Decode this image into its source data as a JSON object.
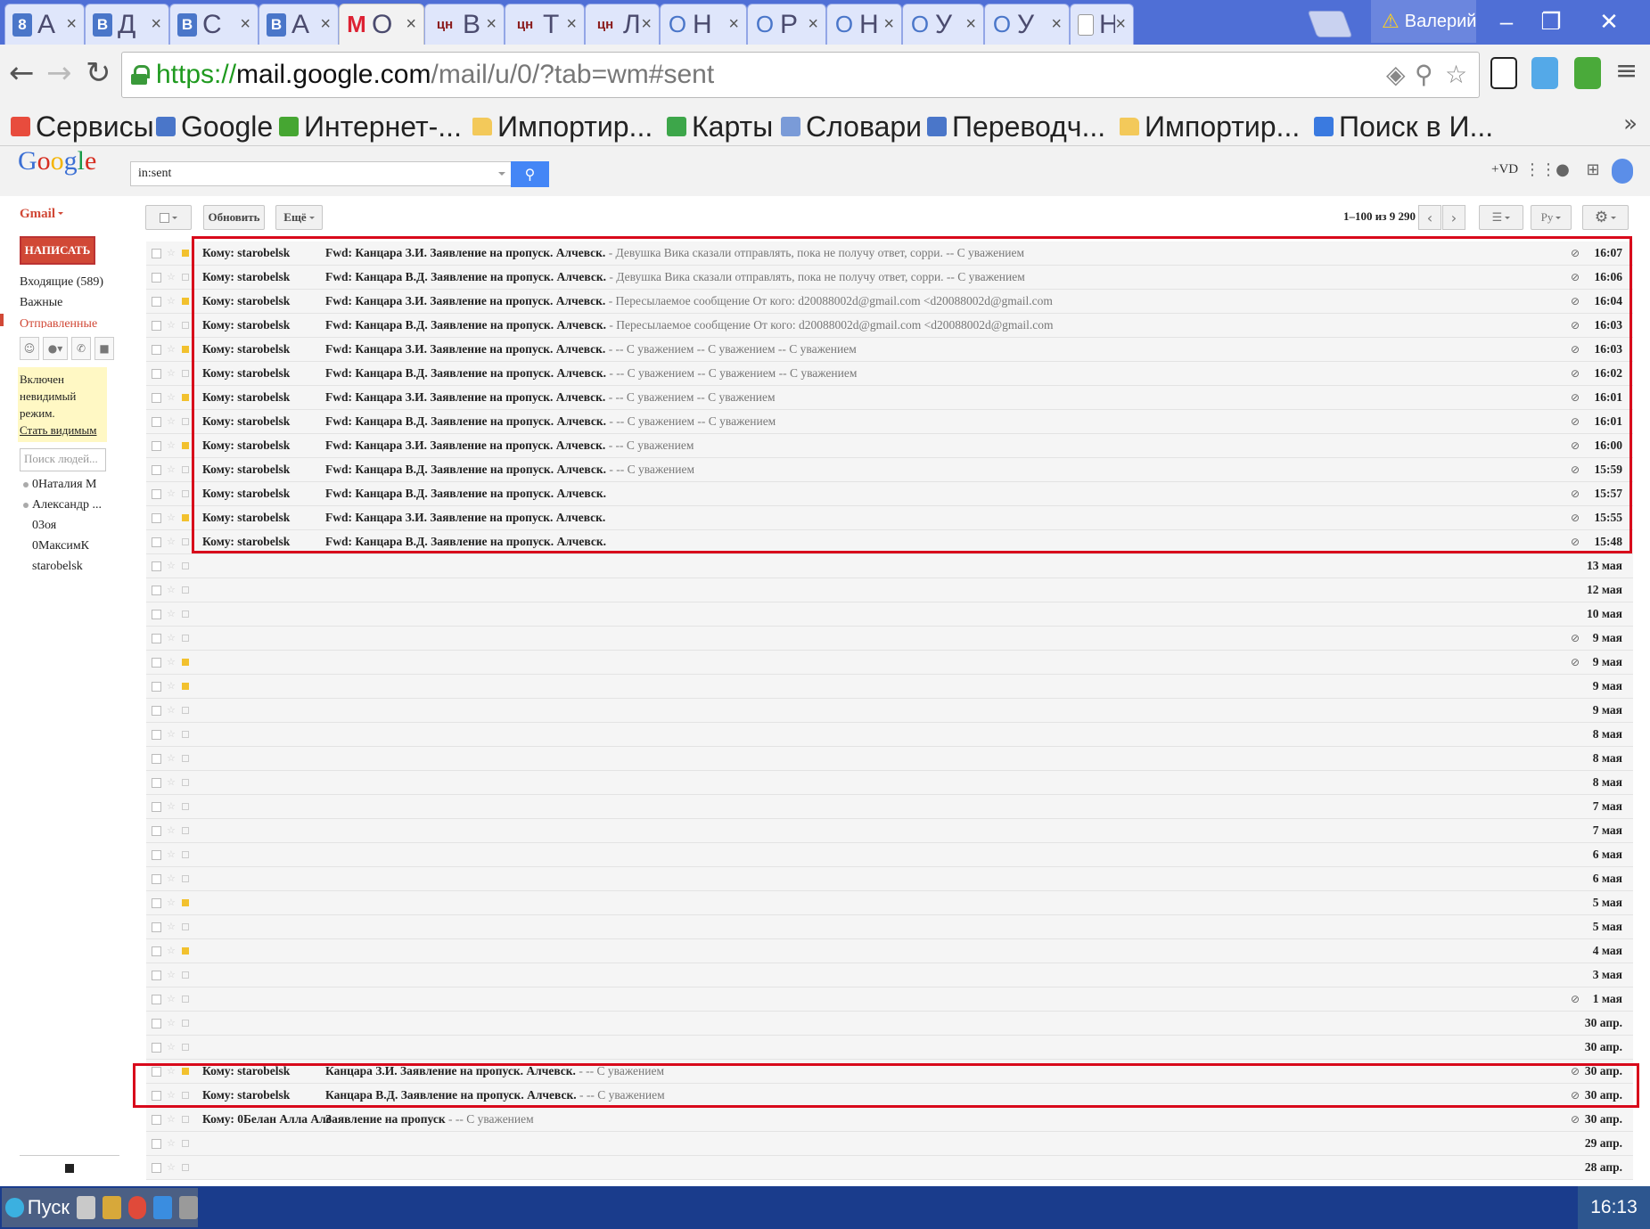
{
  "browser": {
    "tabs": [
      {
        "icon": "8",
        "label": "А",
        "kind": "vk"
      },
      {
        "icon": "B",
        "label": "Д",
        "kind": "vk"
      },
      {
        "icon": "B",
        "label": "С",
        "kind": "vk"
      },
      {
        "icon": "B",
        "label": "А",
        "kind": "vk"
      },
      {
        "icon": "M",
        "label": "О",
        "kind": "gm",
        "active": true
      },
      {
        "icon": "цн",
        "label": "В",
        "kind": "cn"
      },
      {
        "icon": "цн",
        "label": "Т",
        "kind": "cn"
      },
      {
        "icon": "цн",
        "label": "Л",
        "kind": "cn"
      },
      {
        "icon": "O",
        "label": "Н",
        "kind": "op"
      },
      {
        "icon": "O",
        "label": "Р",
        "kind": "op"
      },
      {
        "icon": "O",
        "label": "Н",
        "kind": "op"
      },
      {
        "icon": "O",
        "label": "У",
        "kind": "op"
      },
      {
        "icon": "O",
        "label": "У",
        "kind": "op"
      },
      {
        "icon": "",
        "label": "Н",
        "kind": "doc"
      }
    ],
    "close_glyph": "×",
    "profile_name": "Валерий",
    "url": {
      "scheme": "https://",
      "host": "mail.google.com",
      "path": "/mail/u/0/?tab=wm#sent"
    },
    "bookmarks": [
      {
        "label": "Сервисы",
        "icon_color": "#e84c3d",
        "kind": "apps"
      },
      {
        "label": "Google",
        "icon_color": "#4a76c9",
        "kind": "site"
      },
      {
        "label": "Интернет-...",
        "icon_color": "#46a632",
        "kind": "site"
      },
      {
        "label": "Импортир...",
        "icon_color": "#f3c95a",
        "kind": "folder"
      },
      {
        "label": "Карты",
        "icon_color": "#3da64a",
        "kind": "site"
      },
      {
        "label": "Словари",
        "icon_color": "#7a9bd8",
        "kind": "site"
      },
      {
        "label": "Переводч...",
        "icon_color": "#4a76c9",
        "kind": "site"
      },
      {
        "label": "Импортир...",
        "icon_color": "#f3c95a",
        "kind": "folder"
      },
      {
        "label": "Поиск в И...",
        "icon_color": "#3a7ae0",
        "kind": "site"
      }
    ],
    "bookmarks_more": "»"
  },
  "gmail": {
    "logo": "Google",
    "search_value": "in:sent",
    "user_label": "+VD",
    "app_label": "Gmail",
    "compose_label": "НАПИСАТЬ",
    "nav": {
      "inbox": "Входящие (589)",
      "important": "Важные",
      "sent": "Отправленные"
    },
    "invisible": {
      "line1": "Включен",
      "line2": "невидимый",
      "line3": "режим.",
      "link": "Стать видимым"
    },
    "people_search_placeholder": "Поиск людей...",
    "contacts": [
      "0Наталия М",
      "Александр ...",
      "03оя",
      "0МаксимК",
      "starobelsk"
    ],
    "toolbar": {
      "refresh": "Обновить",
      "more": "Ещё",
      "pager": "1–100 из 9 290",
      "lang": "Ру"
    },
    "messages": [
      {
        "to": "Кому: starobelsk",
        "subject": "Fwd: Канцара З.И. Заявление на пропуск. Алчевск.",
        "snippet": " - Девушка Вика сказали отправлять, пока не получу ответ, сорри. -- С уважением",
        "date": "16:07",
        "imp": true,
        "clip": true
      },
      {
        "to": "Кому: starobelsk",
        "subject": "Fwd: Канцара В.Д. Заявление на пропуск. Алчевск.",
        "snippet": " - Девушка Вика сказали отправлять, пока не получу ответ, сорри. -- С уважением",
        "date": "16:06",
        "imp": false,
        "clip": true
      },
      {
        "to": "Кому: starobelsk",
        "subject": "Fwd: Канцара З.И. Заявление на пропуск. Алчевск.",
        "snippet": " -  Пересылаемое сообщение От кого: d20088002d@gmail.com <d20088002d@gmail.com",
        "date": "16:04",
        "imp": true,
        "clip": true
      },
      {
        "to": "Кому: starobelsk",
        "subject": "Fwd: Канцара В.Д. Заявление на пропуск. Алчевск.",
        "snippet": " -  Пересылаемое сообщение От кого: d20088002d@gmail.com <d20088002d@gmail.com",
        "date": "16:03",
        "imp": false,
        "clip": true
      },
      {
        "to": "Кому: starobelsk",
        "subject": "Fwd: Канцара З.И. Заявление на пропуск. Алчевск.",
        "snippet": " - -- С уважением -- С уважением -- С уважением",
        "date": "16:03",
        "imp": true,
        "clip": true
      },
      {
        "to": "Кому: starobelsk",
        "subject": "Fwd: Канцара В.Д. Заявление на пропуск. Алчевск.",
        "snippet": " - -- С уважением -- С уважением -- С уважением",
        "date": "16:02",
        "imp": false,
        "clip": true
      },
      {
        "to": "Кому: starobelsk",
        "subject": "Fwd: Канцара З.И. Заявление на пропуск. Алчевск.",
        "snippet": " - -- С уважением -- С уважением",
        "date": "16:01",
        "imp": true,
        "clip": true
      },
      {
        "to": "Кому: starobelsk",
        "subject": "Fwd: Канцара В.Д. Заявление на пропуск. Алчевск.",
        "snippet": " - -- С уважением -- С уважением",
        "date": "16:01",
        "imp": false,
        "clip": true
      },
      {
        "to": "Кому: starobelsk",
        "subject": "Fwd: Канцара З.И. Заявление на пропуск. Алчевск.",
        "snippet": " - -- С уважением",
        "date": "16:00",
        "imp": true,
        "clip": true
      },
      {
        "to": "Кому: starobelsk",
        "subject": "Fwd: Канцара В.Д. Заявление на пропуск. Алчевск.",
        "snippet": " - -- С уважением",
        "date": "15:59",
        "imp": false,
        "clip": true
      },
      {
        "to": "Кому: starobelsk",
        "subject": "Fwd: Канцара В.Д. Заявление на пропуск. Алчевск.",
        "snippet": "",
        "date": "15:57",
        "imp": false,
        "clip": true
      },
      {
        "to": "Кому: starobelsk",
        "subject": "Fwd: Канцара З.И. Заявление на пропуск. Алчевск.",
        "snippet": "",
        "date": "15:55",
        "imp": true,
        "clip": true
      },
      {
        "to": "Кому: starobelsk",
        "subject": "Fwd: Канцара В.Д. Заявление на пропуск. Алчевск.",
        "snippet": "",
        "date": "15:48",
        "imp": false,
        "clip": true
      },
      {
        "to": "",
        "subject": "",
        "snippet": "",
        "date": "13 мая",
        "imp": false,
        "clip": false
      },
      {
        "to": "",
        "subject": "",
        "snippet": "",
        "date": "12 мая",
        "imp": false,
        "clip": false
      },
      {
        "to": "",
        "subject": "",
        "snippet": "",
        "date": "10 мая",
        "imp": false,
        "clip": false
      },
      {
        "to": "",
        "subject": "",
        "snippet": "",
        "date": "9 мая",
        "imp": false,
        "clip": true
      },
      {
        "to": "",
        "subject": "",
        "snippet": "",
        "date": "9 мая",
        "imp": true,
        "clip": true
      },
      {
        "to": "",
        "subject": "",
        "snippet": "",
        "date": "9 мая",
        "imp": true,
        "clip": false
      },
      {
        "to": "",
        "subject": "",
        "snippet": "",
        "date": "9 мая",
        "imp": false,
        "clip": false
      },
      {
        "to": "",
        "subject": "",
        "snippet": "",
        "date": "8 мая",
        "imp": false,
        "clip": false
      },
      {
        "to": "",
        "subject": "",
        "snippet": "",
        "date": "8 мая",
        "imp": false,
        "clip": false
      },
      {
        "to": "",
        "subject": "",
        "snippet": "",
        "date": "8 мая",
        "imp": false,
        "clip": false
      },
      {
        "to": "",
        "subject": "",
        "snippet": "",
        "date": "7 мая",
        "imp": false,
        "clip": false
      },
      {
        "to": "",
        "subject": "",
        "snippet": "",
        "date": "7 мая",
        "imp": false,
        "clip": false
      },
      {
        "to": "",
        "subject": "",
        "snippet": "",
        "date": "6 мая",
        "imp": false,
        "clip": false
      },
      {
        "to": "",
        "subject": "",
        "snippet": "",
        "date": "6 мая",
        "imp": false,
        "clip": false
      },
      {
        "to": "",
        "subject": "",
        "snippet": "",
        "date": "5 мая",
        "imp": true,
        "clip": false
      },
      {
        "to": "",
        "subject": "",
        "snippet": "",
        "date": "5 мая",
        "imp": false,
        "clip": false
      },
      {
        "to": "",
        "subject": "",
        "snippet": "",
        "date": "4 мая",
        "imp": true,
        "clip": false
      },
      {
        "to": "",
        "subject": "",
        "snippet": "",
        "date": "3 мая",
        "imp": false,
        "clip": false
      },
      {
        "to": "",
        "subject": "",
        "snippet": "",
        "date": "1 мая",
        "imp": false,
        "clip": true
      },
      {
        "to": "",
        "subject": "",
        "snippet": "",
        "date": "30 апр.",
        "imp": false,
        "clip": false
      },
      {
        "to": "",
        "subject": "",
        "snippet": "",
        "date": "30 апр.",
        "imp": false,
        "clip": false
      },
      {
        "to": "Кому: starobelsk",
        "subject": "Канцара З.И. Заявление на пропуск. Алчевск.",
        "snippet": " - -- С уважением",
        "date": "30 апр.",
        "imp": true,
        "clip": true
      },
      {
        "to": "Кому: starobelsk",
        "subject": "Канцара В.Д. Заявление на пропуск. Алчевск.",
        "snippet": " - -- С уважением",
        "date": "30 апр.",
        "imp": false,
        "clip": true
      },
      {
        "to": "Кому: 0Белан Алла Але",
        "subject": "Заявление на пропуск",
        "snippet": " - -- С уважением",
        "date": "30 апр.",
        "imp": false,
        "clip": true
      },
      {
        "to": "",
        "subject": "",
        "snippet": "",
        "date": "29 апр.",
        "imp": false,
        "clip": false
      },
      {
        "to": "",
        "subject": "",
        "snippet": "",
        "date": "28 апр.",
        "imp": false,
        "clip": false
      }
    ]
  },
  "taskbar": {
    "start_label": "Пуск",
    "clock": "16:13"
  },
  "colors": {
    "tabbar": "#4f6fd6",
    "gmail_red": "#d14836",
    "search_blue": "#4486f6",
    "highlight_box": "#d8091b"
  }
}
